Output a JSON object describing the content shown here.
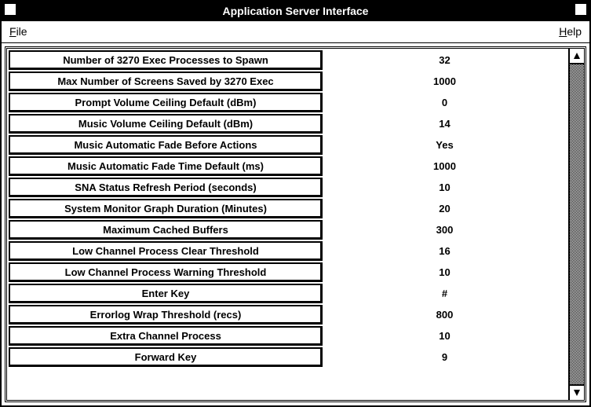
{
  "window": {
    "title": "Application Server Interface"
  },
  "menubar": {
    "file": "File",
    "help": "Help"
  },
  "rows": [
    {
      "label": "Number of 3270 Exec Processes to Spawn",
      "value": "32"
    },
    {
      "label": "Max Number of Screens Saved by 3270 Exec",
      "value": "1000"
    },
    {
      "label": "Prompt Volume Ceiling Default (dBm)",
      "value": "0"
    },
    {
      "label": "Music Volume Ceiling Default (dBm)",
      "value": "14"
    },
    {
      "label": "Music Automatic Fade Before Actions",
      "value": "Yes"
    },
    {
      "label": "Music Automatic Fade Time Default (ms)",
      "value": "1000"
    },
    {
      "label": "SNA Status Refresh Period (seconds)",
      "value": "10"
    },
    {
      "label": "System Monitor Graph Duration (Minutes)",
      "value": "20"
    },
    {
      "label": "Maximum Cached Buffers",
      "value": "300"
    },
    {
      "label": "Low Channel Process Clear Threshold",
      "value": "16"
    },
    {
      "label": "Low Channel Process Warning Threshold",
      "value": "10"
    },
    {
      "label": "Enter Key",
      "value": "#"
    },
    {
      "label": "Errorlog Wrap Threshold (recs)",
      "value": "800"
    },
    {
      "label": "Extra Channel Process",
      "value": "10"
    },
    {
      "label": "Forward Key",
      "value": "9"
    }
  ]
}
